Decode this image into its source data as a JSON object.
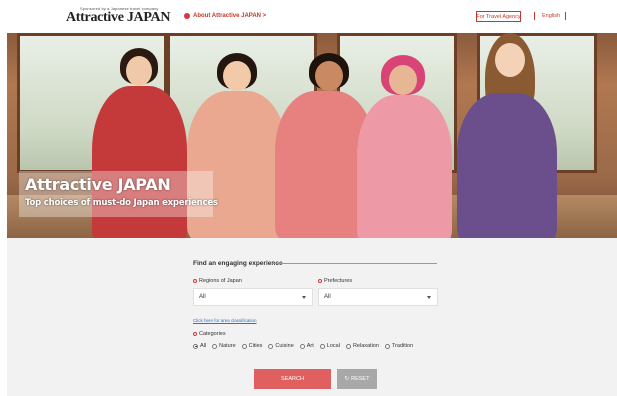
{
  "header": {
    "logo_tagline": "Sponsored by a Japanese travel company",
    "logo_name": "Attractive JAPAN",
    "about_link": "About Attractive JAPAN >",
    "agency_button": "For Travel Agency",
    "language": "English"
  },
  "hero": {
    "title": "Attractive JAPAN",
    "subtitle": "Top choices of must-do Japan experiences"
  },
  "search": {
    "heading": "Find an engaging experience",
    "regions_label": "Regions of Japan",
    "regions_value": "All",
    "prefectures_label": "Prefectures",
    "prefectures_value": "All",
    "area_link": "Click here for area classification",
    "categories_label": "Categories",
    "categories": [
      "All",
      "Nature",
      "Cities",
      "Cuisine",
      "Art",
      "Local",
      "Relaxation",
      "Tradition"
    ],
    "selected_category": "All",
    "search_button": "SEARCH",
    "reset_button": "RESET",
    "reset_icon": "refresh-icon"
  },
  "colors": {
    "accent": "#c0392b",
    "search_button": "#e0605f",
    "reset_button": "#a8a8a8",
    "panel_bg": "#f2f2f2"
  }
}
